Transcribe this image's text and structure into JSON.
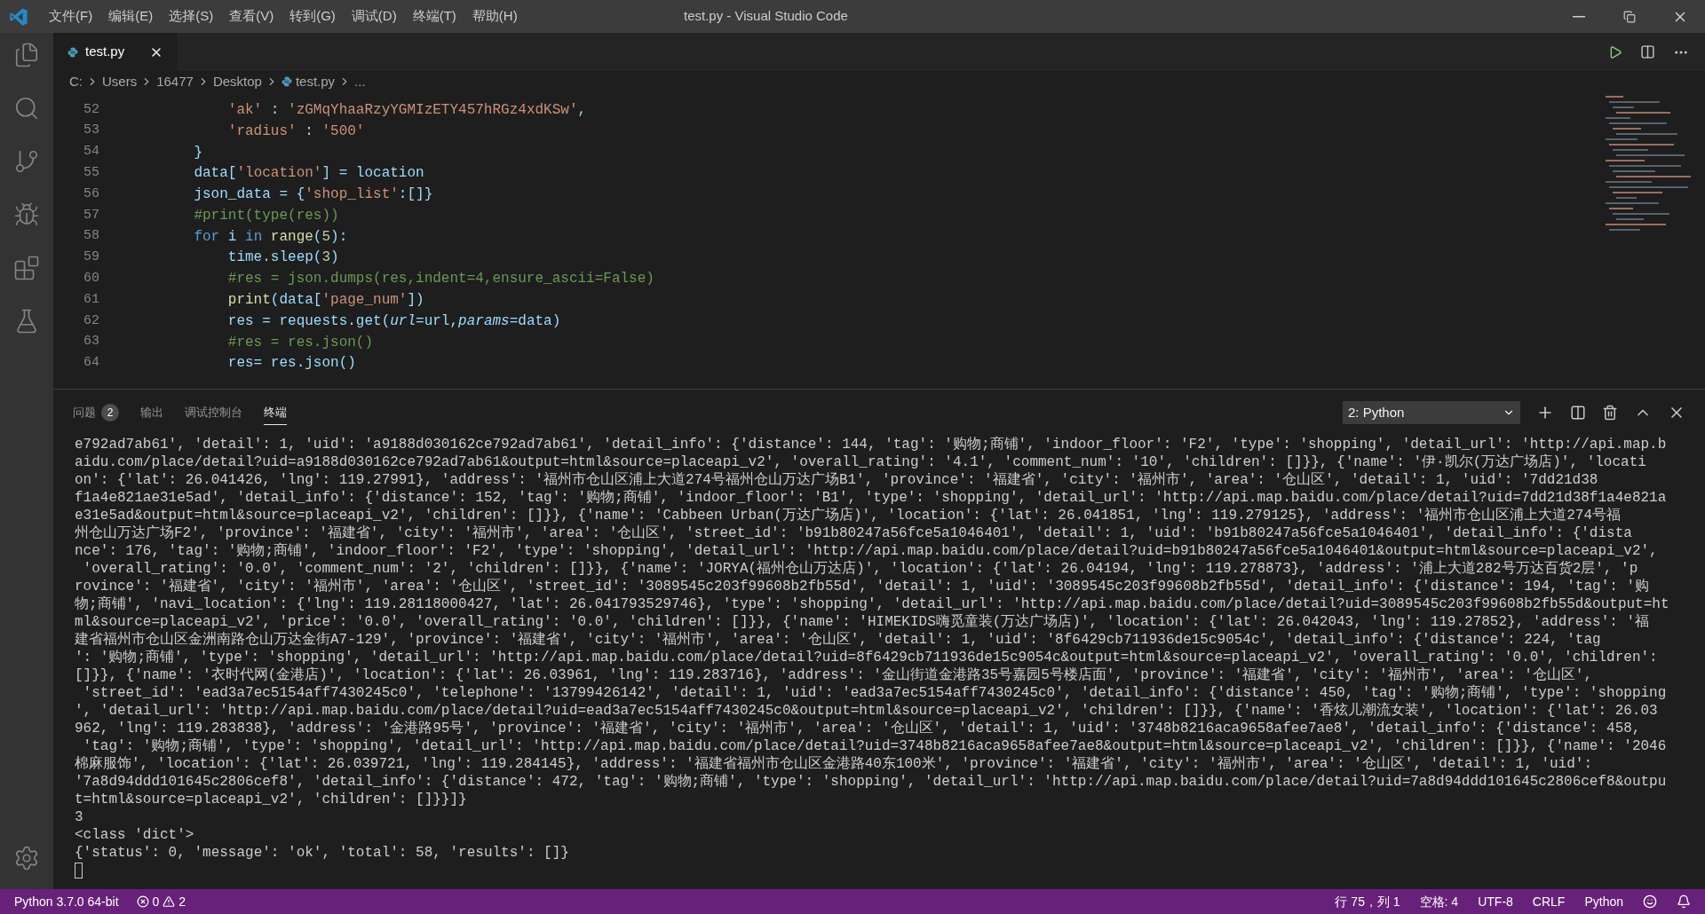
{
  "window": {
    "title": "test.py - Visual Studio Code"
  },
  "menu": [
    "文件(F)",
    "编辑(E)",
    "选择(S)",
    "查看(V)",
    "转到(G)",
    "调试(D)",
    "终端(T)",
    "帮助(H)"
  ],
  "editor_tabs": [
    {
      "label": "test.py",
      "selected": true
    }
  ],
  "breadcrumb": [
    "C:",
    "Users",
    "16477",
    "Desktop",
    "test.py",
    "..."
  ],
  "editor": {
    "lines": [
      {
        "number": "52",
        "tokens": [
          {
            "kind": "str",
            "t": "        'ak'"
          },
          {
            "kind": "plain",
            "t": " : "
          },
          {
            "kind": "str",
            "t": "'zGMqYhaaRzyYGMIzETY457hRGz4xdKSw'"
          },
          {
            "kind": "plain",
            "t": ","
          }
        ]
      },
      {
        "number": "53",
        "tokens": [
          {
            "kind": "str",
            "t": "        'radius'"
          },
          {
            "kind": "plain",
            "t": " : "
          },
          {
            "kind": "str",
            "t": "'500'"
          }
        ]
      },
      {
        "number": "54",
        "tokens": [
          {
            "kind": "plain",
            "t": "    }"
          }
        ]
      },
      {
        "number": "55",
        "tokens": [
          {
            "kind": "plain",
            "t": "    data["
          },
          {
            "kind": "str",
            "t": "'location'"
          },
          {
            "kind": "plain",
            "t": "] = location"
          }
        ]
      },
      {
        "number": "56",
        "tokens": [
          {
            "kind": "plain",
            "t": "    json_data = {"
          },
          {
            "kind": "str",
            "t": "'shop_list'"
          },
          {
            "kind": "plain",
            "t": ":[]}"
          }
        ]
      },
      {
        "number": "57",
        "tokens": [
          {
            "kind": "comment",
            "t": "    #print(type(res))"
          }
        ]
      },
      {
        "number": "58",
        "tokens": [
          {
            "kind": "keyword",
            "t": "    for"
          },
          {
            "kind": "plain",
            "t": " i "
          },
          {
            "kind": "keyword",
            "t": "in "
          },
          {
            "kind": "function",
            "t": "range"
          },
          {
            "kind": "plain",
            "t": "("
          },
          {
            "kind": "number",
            "t": "5"
          },
          {
            "kind": "plain",
            "t": "):"
          }
        ]
      },
      {
        "number": "59",
        "tokens": [
          {
            "kind": "plain",
            "t": "        time.sleep("
          },
          {
            "kind": "number",
            "t": "3"
          },
          {
            "kind": "plain",
            "t": ")"
          }
        ]
      },
      {
        "number": "60",
        "tokens": [
          {
            "kind": "comment",
            "t": "        #res = json.dumps(res,indent=4,ensure_ascii=False)"
          }
        ]
      },
      {
        "number": "61",
        "tokens": [
          {
            "kind": "function",
            "t": "        print"
          },
          {
            "kind": "plain",
            "t": "(data["
          },
          {
            "kind": "str",
            "t": "'page_num'"
          },
          {
            "kind": "plain",
            "t": "])"
          }
        ]
      },
      {
        "number": "62",
        "tokens": [
          {
            "kind": "plain",
            "t": "        res = requests.get("
          },
          {
            "kind": "param",
            "t": "url"
          },
          {
            "kind": "plain",
            "t": "=url,"
          },
          {
            "kind": "param",
            "t": "params"
          },
          {
            "kind": "plain",
            "t": "=data)"
          }
        ]
      },
      {
        "number": "63",
        "tokens": [
          {
            "kind": "comment",
            "t": "        #res = res.json()"
          }
        ]
      },
      {
        "number": "64",
        "tokens": [
          {
            "kind": "plain",
            "t": "        res= res.json()"
          }
        ]
      }
    ]
  },
  "panel": {
    "tabs": [
      {
        "label": "问题",
        "badge": "2",
        "selected": false
      },
      {
        "label": "输出",
        "selected": false
      },
      {
        "label": "调试控制台",
        "selected": false
      },
      {
        "label": "终端",
        "selected": true
      }
    ],
    "terminal_select": "2: Python",
    "terminal_lines": [
      "e792ad7ab61', 'detail': 1, 'uid': 'a9188d030162ce792ad7ab61', 'detail_info': {'distance': 144, 'tag': '购物;商铺', 'indoor_floor': 'F2', 'type': 'shopping', 'detail_url': 'http://api.map.b",
      "aidu.com/place/detail?uid=a9188d030162ce792ad7ab61&output=html&source=placeapi_v2', 'overall_rating': '4.1', 'comment_num': '10', 'children': []}}, {'name': '伊·凯尔(万达广场店)', 'locati",
      "on': {'lat': 26.041426, 'lng': 119.27991}, 'address': '福州市仓山区浦上大道274号福州仓山万达广场B1', 'province': '福建省', 'city': '福州市', 'area': '仓山区', 'detail': 1, 'uid': '7dd21d38",
      "f1a4e821ae31e5ad', 'detail_info': {'distance': 152, 'tag': '购物;商铺', 'indoor_floor': 'B1', 'type': 'shopping', 'detail_url': 'http://api.map.baidu.com/place/detail?uid=7dd21d38f1a4e821a",
      "e31e5ad&output=html&source=placeapi_v2', 'children': []}}, {'name': 'Cabbeen Urban(万达广场店)', 'location': {'lat': 26.041851, 'lng': 119.279125}, 'address': '福州市仓山区浦上大道274号福",
      "州仓山万达广场F2', 'province': '福建省', 'city': '福州市', 'area': '仓山区', 'street_id': 'b91b80247a56fce5a1046401', 'detail': 1, 'uid': 'b91b80247a56fce5a1046401', 'detail_info': {'dista",
      "nce': 176, 'tag': '购物;商铺', 'indoor_floor': 'F2', 'type': 'shopping', 'detail_url': 'http://api.map.baidu.com/place/detail?uid=b91b80247a56fce5a1046401&output=html&source=placeapi_v2',",
      " 'overall_rating': '0.0', 'comment_num': '2', 'children': []}}, {'name': 'JORYA(福州仓山万达店)', 'location': {'lat': 26.04194, 'lng': 119.278873}, 'address': '浦上大道282号万达百货2层', 'p",
      "rovince': '福建省', 'city': '福州市', 'area': '仓山区', 'street_id': '3089545c203f99608b2fb55d', 'detail': 1, 'uid': '3089545c203f99608b2fb55d', 'detail_info': {'distance': 194, 'tag': '购",
      "物;商铺', 'navi_location': {'lng': 119.28118000427, 'lat': 26.041793529746}, 'type': 'shopping', 'detail_url': 'http://api.map.baidu.com/place/detail?uid=3089545c203f99608b2fb55d&output=ht",
      "ml&source=placeapi_v2', 'price': '0.0', 'overall_rating': '0.0', 'children': []}}, {'name': 'HIMEKIDS嗨觅童装(万达广场店)', 'location': {'lat': 26.042043, 'lng': 119.27852}, 'address': '福",
      "建省福州市仓山区金洲南路仓山万达金街A7-129', 'province': '福建省', 'city': '福州市', 'area': '仓山区', 'detail': 1, 'uid': '8f6429cb711936de15c9054c', 'detail_info': {'distance': 224, 'tag",
      "': '购物;商铺', 'type': 'shopping', 'detail_url': 'http://api.map.baidu.com/place/detail?uid=8f6429cb711936de15c9054c&output=html&source=placeapi_v2', 'overall_rating': '0.0', 'children':",
      "[]}}, {'name': '衣时代网(金港店)', 'location': {'lat': 26.03961, 'lng': 119.283716}, 'address': '金山街道金港路35号嘉园5号楼店面', 'province': '福建省', 'city': '福州市', 'area': '仓山区',",
      " 'street_id': 'ead3a7ec5154aff7430245c0', 'telephone': '13799426142', 'detail': 1, 'uid': 'ead3a7ec5154aff7430245c0', 'detail_info': {'distance': 450, 'tag': '购物;商铺', 'type': 'shopping",
      "', 'detail_url': 'http://api.map.baidu.com/place/detail?uid=ead3a7ec5154aff7430245c0&output=html&source=placeapi_v2', 'children': []}}, {'name': '香炫儿潮流女装', 'location': {'lat': 26.03",
      "962, 'lng': 119.283838}, 'address': '金港路95号', 'province': '福建省', 'city': '福州市', 'area': '仓山区', 'detail': 1, 'uid': '3748b8216aca9658afee7ae8', 'detail_info': {'distance': 458,",
      " 'tag': '购物;商铺', 'type': 'shopping', 'detail_url': 'http://api.map.baidu.com/place/detail?uid=3748b8216aca9658afee7ae8&output=html&source=placeapi_v2', 'children': []}}, {'name': '2046",
      "棉麻服饰', 'location': {'lat': 26.039721, 'lng': 119.284145}, 'address': '福建省福州市仓山区金港路40东100米', 'province': '福建省', 'city': '福州市', 'area': '仓山区', 'detail': 1, 'uid':",
      "'7a8d94ddd101645c2806cef8', 'detail_info': {'distance': 472, 'tag': '购物;商铺', 'type': 'shopping', 'detail_url': 'http://api.map.baidu.com/place/detail?uid=7a8d94ddd101645c2806cef8&outpu",
      "t=html&source=placeapi_v2', 'children': []}}]}",
      "3",
      "<class 'dict'>",
      "{'status': 0, 'message': 'ok', 'total': 58, 'results': []}"
    ]
  },
  "status_bar": {
    "interpreter": "Python 3.7.0 64-bit",
    "errors": "0",
    "warnings": "2",
    "position": "行 75，列 1",
    "indent": "空格: 4",
    "encoding": "UTF-8",
    "eol": "CRLF",
    "language": "Python"
  }
}
